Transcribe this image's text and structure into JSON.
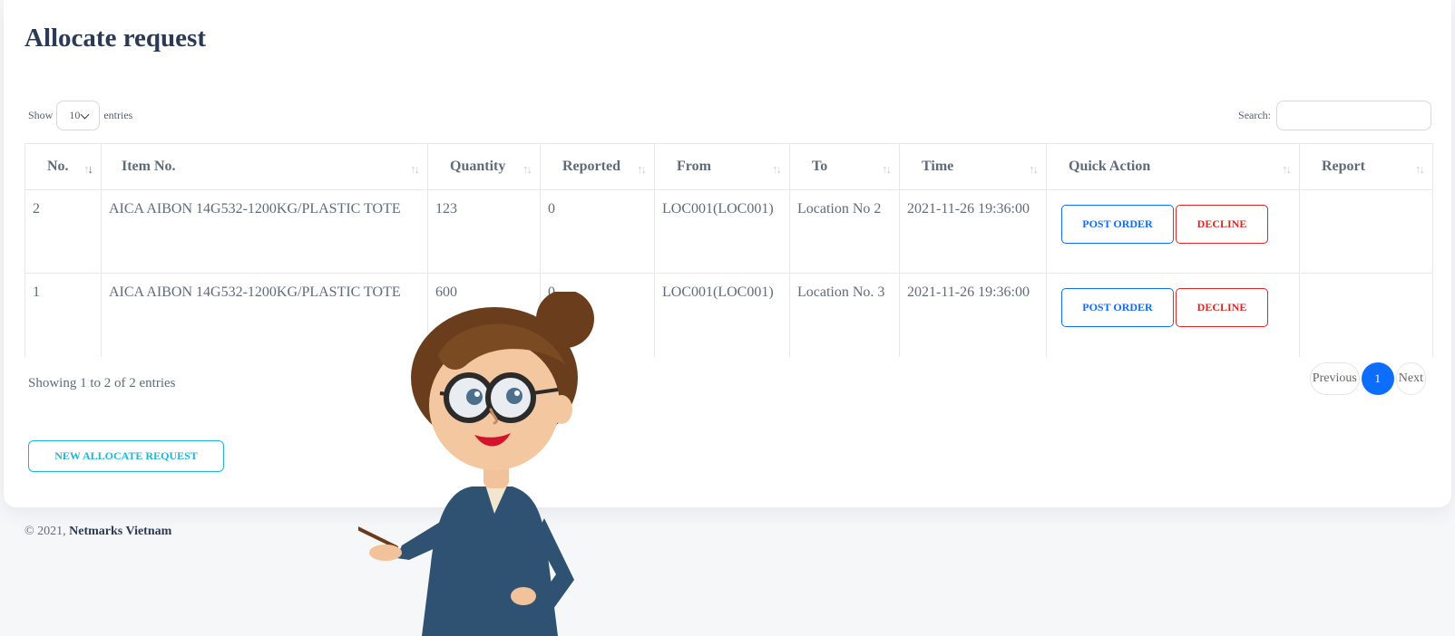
{
  "page": {
    "title": "Allocate request"
  },
  "length": {
    "label_before": "Show",
    "value": "10",
    "label_after": "entries"
  },
  "search": {
    "label": "Search:"
  },
  "table": {
    "headers": [
      "No.",
      "Item No.",
      "Quantity",
      "Reported",
      "From",
      "To",
      "Time",
      "Quick Action",
      "Report"
    ],
    "rows": [
      {
        "no": "2",
        "item": "AICA AIBON 14G532-1200KG/PLASTIC TOTE",
        "quantity": "123",
        "reported": "0",
        "from": "LOC001(LOC001)",
        "to": "Location No 2",
        "time": "2021-11-26 19:36:00",
        "report": ""
      },
      {
        "no": "1",
        "item": "AICA AIBON 14G532-1200KG/PLASTIC TOTE",
        "quantity": "600",
        "reported": "0",
        "from": "LOC001(LOC001)",
        "to": "Location No. 3",
        "time": "2021-11-26 19:36:00",
        "report": ""
      }
    ],
    "post_label": "POST ORDER",
    "decline_label": "DECLINE"
  },
  "info": "Showing 1 to 2 of 2 entries",
  "pagination": {
    "previous": "Previous",
    "current": "1",
    "next": "Next"
  },
  "new_button": "NEW ALLOCATE REQUEST",
  "footer": {
    "prefix": "© 2021,",
    "company": "Netmarks Vietnam"
  },
  "colors": {
    "primary": "#0d6efd",
    "danger": "#e02424",
    "info": "#1bb6d9",
    "title": "#2d3a55"
  },
  "icons": {
    "sort": "sort-arrows-icon",
    "dropdown": "chevron-down-icon"
  }
}
